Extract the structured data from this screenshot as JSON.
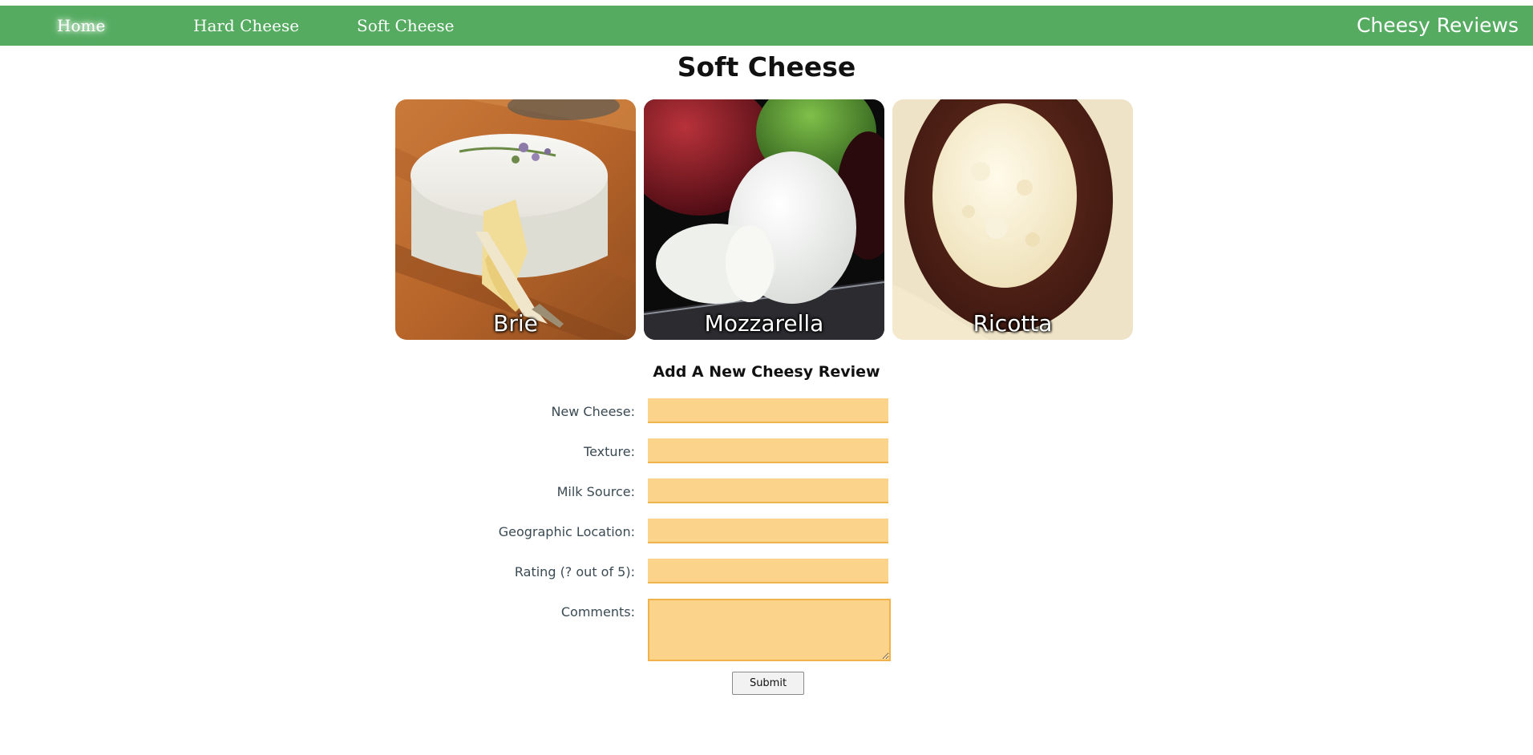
{
  "nav": {
    "items": [
      {
        "label": "Home",
        "active": true
      },
      {
        "label": "Hard Cheese",
        "active": false
      },
      {
        "label": "Soft Cheese",
        "active": false
      }
    ],
    "brand": "Cheesy Reviews",
    "bar_color": "#55ac61"
  },
  "page": {
    "title": "Soft Cheese"
  },
  "cheeses": [
    {
      "name": "Brie"
    },
    {
      "name": "Mozzarella"
    },
    {
      "name": "Ricotta"
    }
  ],
  "form": {
    "title": "Add A New Cheesy Review",
    "fields": [
      {
        "label": "New Cheese:",
        "value": ""
      },
      {
        "label": "Texture:",
        "value": ""
      },
      {
        "label": "Milk Source:",
        "value": ""
      },
      {
        "label": "Geographic Location:",
        "value": ""
      },
      {
        "label": "Rating (? out of 5):",
        "value": ""
      },
      {
        "label": "Comments:",
        "value": ""
      }
    ],
    "submit_label": "Submit",
    "input_color": "#fcd38a"
  }
}
